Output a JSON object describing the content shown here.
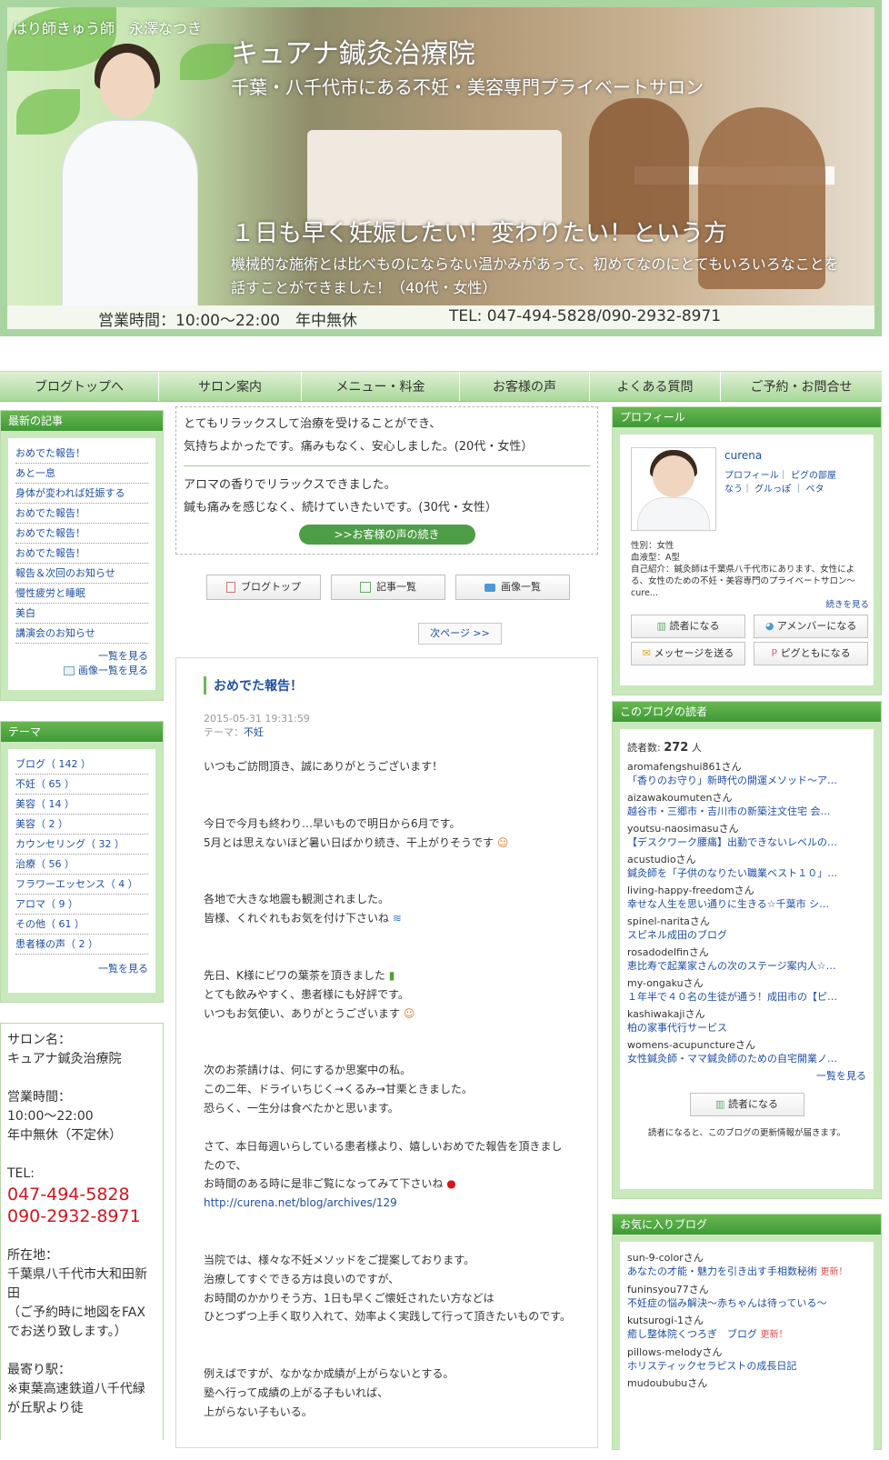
{
  "header": {
    "author": "はり師きゅう師　永澤なつき",
    "title": "キュアナ鍼灸治療院",
    "subtitle": "千葉・八千代市にある不妊・美容専門プライベートサロン",
    "catch": "１日も早く妊娠したい！変わりたい！という方",
    "quote": "機械的な施術とは比べものにならない温かみがあって、初めてなのにとてもいろいろなことを話すことができました！（40代・女性）",
    "hours": "営業時間：10:00〜22:00　年中無休",
    "tel": "TEL: 047-494-5828/090-2932-8971"
  },
  "nav": [
    "ブログトップへ",
    "サロン案内",
    "メニュー・料金",
    "お客様の声",
    "よくある質問",
    "ご予約・お問合せ"
  ],
  "recent": {
    "title": "最新の記事",
    "items": [
      "おめでた報告！",
      "あと一息",
      "身体が変われば妊娠する",
      "おめでた報告！",
      "おめでた報告！",
      "おめでた報告！",
      "報告＆次回のお知らせ",
      "慢性疲労と睡眠",
      "美白",
      "講演会のお知らせ"
    ],
    "more": "一覧を見る",
    "images": "画像一覧を見る"
  },
  "themes": {
    "title": "テーマ",
    "items": [
      "ブログ（ 142 ）",
      "不妊（ 65 ）",
      "美容（ 14 ）",
      "美容（ 2 ）",
      "カウンセリング（ 32 ）",
      "治療（ 56 ）",
      "フラワーエッセンス（ 4 ）",
      "アロマ（ 9 ）",
      "その他（ 61 ）",
      "患者様の声（ 2 ）"
    ],
    "more": "一覧を見る"
  },
  "salon": {
    "name_label": "サロン名：",
    "name": "キュアナ鍼灸治療院",
    "hours_label": "営業時間：",
    "hours": "10:00〜22:00",
    "holiday": "年中無休（不定休）",
    "tel_label": "TEL:",
    "tel1": "047-494-5828",
    "tel2": "090-2932-8971",
    "addr_label": "所在地：",
    "addr": "千葉県八千代市大和田新田",
    "addr_note": "（ご予約時に地図をFAXでお送り致します。）",
    "station_label": "最寄り駅：",
    "station": "※東葉高速鉄道八千代緑が丘駅より徒"
  },
  "voices": {
    "v1a": "とてもリラックスして治療を受けることができ、",
    "v1b": "気持ちよかったです。痛みもなく、安心しました。(20代・女性）",
    "v2a": "アロマの香りでリラックスできました。",
    "v2b": "鍼も痛みを感じなく、続けていきたいです。(30代・女性）",
    "more": ">>お客様の声の続き"
  },
  "blognav": {
    "top": "ブログトップ",
    "list": "記事一覧",
    "images": "画像一覧",
    "next": "次ページ >>"
  },
  "article": {
    "title": "おめでた報告！",
    "date": "2015-05-31 19:31:59",
    "theme_label": "テーマ：",
    "theme": "不妊",
    "p1": "いつもご訪問頂き、誠にありがとうございます！",
    "p2a": "今日で今月も終わり…早いもので明日から6月です。",
    "p2b": "5月とは思えないほど暑い日ばかり続き、干上がりそうです",
    "p3a": "各地で大きな地震も観測されました。",
    "p3b": "皆様、くれぐれもお気を付け下さいね",
    "p4a": "先日、K様にビワの葉茶を頂きました",
    "p4b": "とても飲みやすく、患者様にも好評です。",
    "p4c": "いつもお気使い、ありがとうございます",
    "p5a": "次のお茶請けは、何にするか思案中の私。",
    "p5b": "この二年、ドライいちじく→くるみ→甘栗ときました。",
    "p5c": "恐らく、一生分は食べたかと思います。",
    "p6a": "さて、本日毎週いらしている患者様より、嬉しいおめでた報告を頂きましたので、",
    "p6b": "お時間のある時に是非ご覧になってみて下さいね",
    "p6link": "http://curena.net/blog/archives/129",
    "p7a": "当院では、様々な不妊メソッドをご提案しております。",
    "p7b": "治療してすぐできる方は良いのですが、",
    "p7c": "お時間のかかりそう方、1日も早くご懐妊されたい方などは",
    "p7d": "ひとつずつ上手く取り入れて、効率よく実践して行って頂きたいものです。",
    "p8a": "例えばですが、なかなか成績が上がらないとする。",
    "p8b": "塾へ行って成績の上がる子もいれば、",
    "p8c": "上がらない子もいる。"
  },
  "profile": {
    "title": "プロフィール",
    "name": "curena",
    "links": "プロフィール｜ ピグの部屋",
    "links2": "なう｜ グルっぽ ｜ ペタ",
    "gender": "性別：女性",
    "blood": "血液型：A型",
    "intro": "自己紹介：鍼灸師は千葉県八千代市にあります、女性による、女性のための不妊・美容専門のプライベートサロン〜cure...",
    "more": "続きを見る",
    "btn_read": "読者になる",
    "btn_amember": "アメンバーになる",
    "btn_msg": "メッセージを送る",
    "btn_pig": "ピグともになる"
  },
  "readers": {
    "title": "このブログの読者",
    "count_label": "読者数:",
    "count": "272",
    "unit": "人",
    "items": [
      {
        "name": "aromafengshui861さん",
        "title": "「香りのお守り」新時代の開運メソッド〜ア…"
      },
      {
        "name": "aizawakoumutenさん",
        "title": "越谷市・三郷市・吉川市の新築注文住宅 会…"
      },
      {
        "name": "youtsu-naosimasuさん",
        "title": "【デスクワーク腰痛】出勤できないレベルの…"
      },
      {
        "name": "acustudioさん",
        "title": "鍼灸師を「子供のなりたい職業ベスト１０」…"
      },
      {
        "name": "living-happy-freedomさん",
        "title": "幸せな人生を思い通りに生きる☆千葉市 シ…"
      },
      {
        "name": "spinel-naritaさん",
        "title": "スピネル成田のブログ"
      },
      {
        "name": "rosadodelfinさん",
        "title": "恵比寿で起業家さんの次のステージ案内人☆…"
      },
      {
        "name": "my-ongakuさん",
        "title": "１年半で４０名の生徒が通う！成田市の【ピ…"
      },
      {
        "name": "kashiwakajiさん",
        "title": "柏の家事代行サービス"
      },
      {
        "name": "womens-acupunctureさん",
        "title": "女性鍼灸師・ママ鍼灸師のための自宅開業ノ…"
      }
    ],
    "more": "一覧を見る",
    "btn_read": "読者になる",
    "note": "読者になると、このブログの更新情報が届きます。"
  },
  "favorites": {
    "title": "お気に入りブログ",
    "items": [
      {
        "name": "sun-9-colorさん",
        "title": "あなたの才能・魅力を引き出す手相数秘術",
        "new": "更新！"
      },
      {
        "name": "funinsyou77さん",
        "title": "不妊症の悩み解決〜赤ちゃんは待っている〜",
        "new": ""
      },
      {
        "name": "kutsurogi-1さん",
        "title": "癒し整体院くつろぎ　ブログ",
        "new": "更新！"
      },
      {
        "name": "pillows-melodyさん",
        "title": "ホリスティックセラピストの成長日記",
        "new": ""
      },
      {
        "name": "mudoububuさん",
        "title": "",
        "new": ""
      }
    ]
  },
  "colors": {
    "accent": "#4d9e46",
    "link": "#1f4fa6",
    "tel": "#d4161d"
  }
}
